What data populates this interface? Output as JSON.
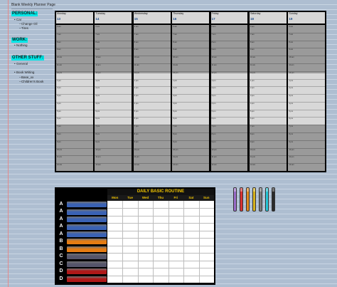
{
  "page_title": "Blank Weekly Planner Page",
  "sections": [
    {
      "heading": "PERSONAL:",
      "items": [
        {
          "label": "Car",
          "level": 1
        },
        {
          "label": "Change Oil",
          "level": 2
        },
        {
          "label": "Tires",
          "level": 2
        }
      ]
    },
    {
      "heading": "WORK:",
      "items": [
        {
          "label": "Nothing",
          "level": 1
        }
      ]
    },
    {
      "heading": "OTHER STUFF:",
      "items": [
        {
          "label": "General",
          "level": 1
        },
        {
          "label": "Book Writing",
          "level": 1
        },
        {
          "label": "Base_xx",
          "level": 2
        },
        {
          "label": "Children's Book",
          "level": 2
        }
      ]
    }
  ],
  "weekly": {
    "days": [
      {
        "name": "Monday",
        "date": "13"
      },
      {
        "name": "Tuesday",
        "date": "14"
      },
      {
        "name": "Wednesday",
        "date": "15"
      },
      {
        "name": "Thursday",
        "date": "16"
      },
      {
        "name": "Friday",
        "date": "17"
      },
      {
        "name": "Saturday",
        "date": "18"
      },
      {
        "name": "Sunday",
        "date": "19"
      }
    ],
    "time_labels": [
      "6 am",
      "7 am",
      "8 am",
      "9 am",
      "10 am",
      "11 am",
      "12 pm",
      "1 pm",
      "2 pm",
      "3 pm",
      "4 pm",
      "5 pm",
      "6 pm",
      "7 pm",
      "8 pm",
      "9 pm",
      "10 pm",
      "11 pm",
      "12 am"
    ],
    "colors": {
      "dark": "#9a9a9a",
      "light": "#d8d8d8",
      "header": "#d7d7d7",
      "date": "#1e4e8c"
    }
  },
  "routine": {
    "title": "DAILY BASIC ROUTINE",
    "days": [
      "Mon",
      "Tue",
      "Wed",
      "Thu",
      "Fri",
      "Sat",
      "Sun"
    ],
    "rows": [
      {
        "letter": "A",
        "color": "#3a62b4"
      },
      {
        "letter": "A",
        "color": "#3a62b4"
      },
      {
        "letter": "A",
        "color": "#3a62b4"
      },
      {
        "letter": "A",
        "color": "#3a62b4"
      },
      {
        "letter": "A",
        "color": "#3a62b4"
      },
      {
        "letter": "B",
        "color": "#e67c12"
      },
      {
        "letter": "B",
        "color": "#e67c12"
      },
      {
        "letter": "C",
        "color": "#55556a"
      },
      {
        "letter": "C",
        "color": "#55556a"
      },
      {
        "letter": "D",
        "color": "#b01818"
      },
      {
        "letter": "D",
        "color": "#b01818"
      }
    ],
    "title_color": "#f0c400"
  },
  "pens": [
    {
      "name": "purple-pen",
      "color": "#9a6cc9"
    },
    {
      "name": "red-pen",
      "color": "#d83232"
    },
    {
      "name": "orange-pen",
      "color": "#e08a1c"
    },
    {
      "name": "gold-pen",
      "color": "#d6b21d"
    },
    {
      "name": "gray-pen",
      "color": "#7a7a7a"
    },
    {
      "name": "cyan-pen",
      "color": "#27c7d8"
    },
    {
      "name": "black-pen",
      "color": "#2a2a2a"
    }
  ]
}
